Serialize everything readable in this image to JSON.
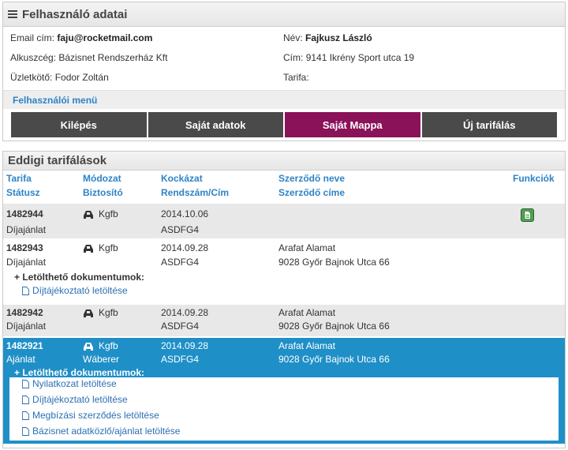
{
  "user_panel": {
    "title": "Felhasználó adatai",
    "email_label": "Email cím:",
    "email": "faju@rocketmail.com",
    "name_label": "Név:",
    "name": "Fajkusz László",
    "agency_label": "Alkuszcég:",
    "agency": "Bázisnet Rendszerház Kft",
    "address_label": "Cím:",
    "address": "9141 Ikrény Sport utca 19",
    "broker_label": "Üzletkötő:",
    "broker": "Fodor Zoltán",
    "tariff_label": "Tarifa:",
    "tariff": "",
    "menu_title": "Felhasználói menü",
    "menu": [
      "Kilépés",
      "Saját adatok",
      "Saját Mappa",
      "Új tarifálás"
    ],
    "menu_active": "Saját Mappa"
  },
  "history_panel": {
    "title": "Eddigi tarifálások",
    "columns": {
      "tariff": "Tarifa",
      "status": "Státusz",
      "mode": "Módozat",
      "insurer": "Biztosító",
      "risk": "Kockázat",
      "plate_addr": "Rendszám/Cím",
      "contractor": "Szerződő neve",
      "contractor_addr": "Szerződő címe",
      "functions": "Funkciók"
    },
    "docs_title": "+ Letölthető dokumentumok:",
    "rows": [
      {
        "id": "1482944",
        "status": "Díjajánlat",
        "mode": "Kgfb",
        "insurer": "",
        "date": "2014.10.06",
        "plate": "ASDFG4",
        "contractor": "",
        "contractor_addr": ""
      },
      {
        "id": "1482943",
        "status": "Díjajánlat",
        "mode": "Kgfb",
        "insurer": "",
        "date": "2014.09.28",
        "plate": "ASDFG4",
        "contractor": "Arafat Alamat",
        "contractor_addr": "9028 Győr Bajnok Utca 66",
        "docs": [
          "Díjtájékoztató letöltése"
        ]
      },
      {
        "id": "1482942",
        "status": "Díjajánlat",
        "mode": "Kgfb",
        "insurer": "",
        "date": "2014.09.28",
        "plate": "ASDFG4",
        "contractor": "Arafat Alamat",
        "contractor_addr": "9028 Győr Bajnok Utca 66"
      },
      {
        "id": "1482921",
        "status": "Ajánlat",
        "mode": "Kgfb",
        "insurer": "Wáberer",
        "date": "2014.09.28",
        "plate": "ASDFG4",
        "contractor": "Arafat Alamat",
        "contractor_addr": "9028 Győr Bajnok Utca 66",
        "docs": [
          "Nyilatkozat letöltése",
          "Díjtájékoztató letöltése",
          "Megbízási szerződés letöltése",
          "Bázisnet adatközlő/ajánlat letöltése"
        ]
      }
    ]
  },
  "colors": {
    "accent": "#2e83c6",
    "active_menu": "#8a1259",
    "selected_row": "#1f8fc7",
    "menu_bg": "#4a4a4a"
  },
  "icons": {
    "menu": "hamburger-icon",
    "vehicle": "car-icon",
    "document": "file-icon",
    "function": "document-green-icon"
  }
}
